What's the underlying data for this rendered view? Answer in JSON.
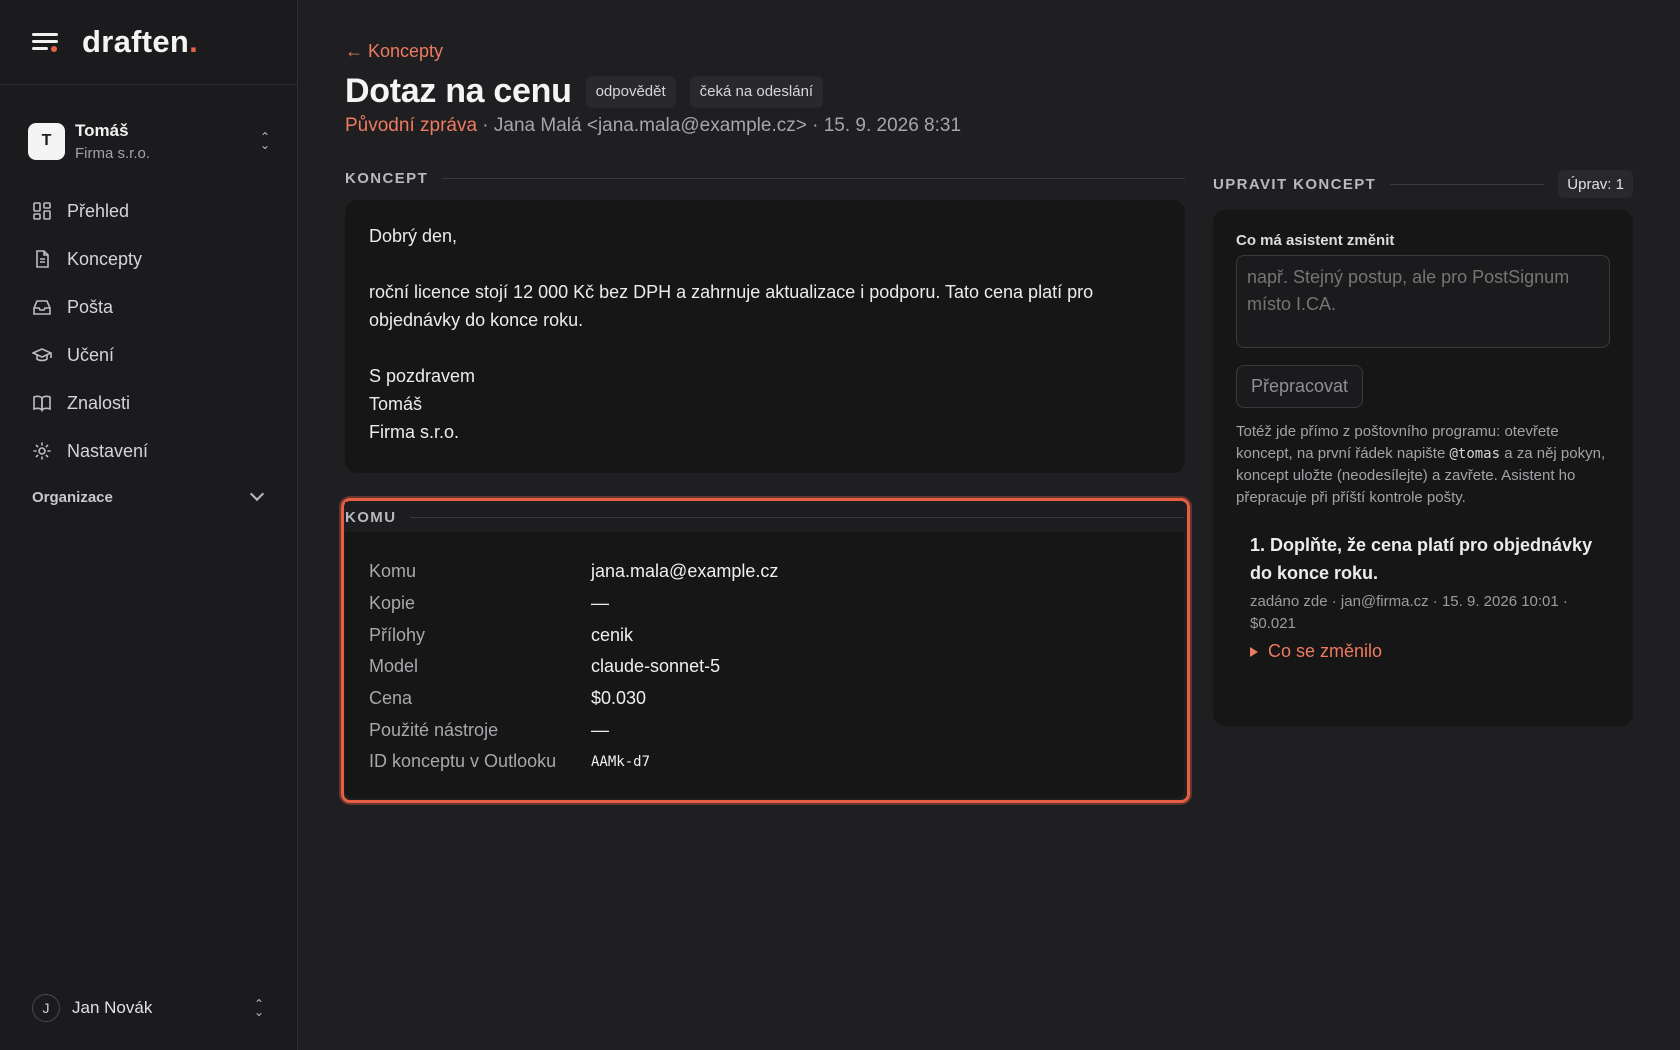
{
  "brand": {
    "name": "draften",
    "dot": "."
  },
  "account": {
    "initial": "T",
    "name": "Tomáš",
    "org": "Firma s.r.o."
  },
  "nav": {
    "items": [
      {
        "label": "Přehled",
        "icon": "dashboard-icon"
      },
      {
        "label": "Koncepty",
        "icon": "document-icon"
      },
      {
        "label": "Pošta",
        "icon": "inbox-icon"
      },
      {
        "label": "Učení",
        "icon": "graduation-cap-icon"
      },
      {
        "label": "Znalosti",
        "icon": "book-icon"
      },
      {
        "label": "Nastavení",
        "icon": "gear-icon"
      }
    ],
    "section": "Organizace"
  },
  "user": {
    "initial": "J",
    "name": "Jan Novák"
  },
  "header": {
    "back": "← Koncepty",
    "title": "Dotaz na cenu",
    "chips": [
      "odpovědět",
      "čeká na odeslání"
    ],
    "original_link": "Původní zpráva",
    "meta": " · Jana Malá <jana.mala@example.cz> · 15. 9. 2026 8:31"
  },
  "draft": {
    "section": "KONCEPT",
    "greeting": "Dobrý den,",
    "body": "roční licence stojí 12 000 Kč bez DPH a zahrnuje aktualizace i podporu. Tato cena platí pro objednávky do konce roku.",
    "closing": "S pozdravem",
    "sign_name": "Tomáš",
    "sign_org": "Firma s.r.o."
  },
  "komu": {
    "section": "KOMU",
    "rows": [
      {
        "key": "Komu",
        "value": "jana.mala@example.cz"
      },
      {
        "key": "Kopie",
        "value": "—"
      },
      {
        "key": "Přílohy",
        "value": "cenik"
      },
      {
        "key": "Model",
        "value": "claude-sonnet-5"
      },
      {
        "key": "Cena",
        "value": "$0.030"
      },
      {
        "key": "Použité nástroje",
        "value": "—"
      },
      {
        "key": "ID konceptu v Outlooku",
        "value": "AAMk-d7"
      }
    ]
  },
  "edit": {
    "section": "UPRAVIT KONCEPT",
    "count": "Úprav: 1",
    "field_label": "Co má asistent změnit",
    "placeholder": "např. Stejný postup, ale pro PostSignum místo I.CA.",
    "button": "Přepracovat",
    "hint_before": "Totéž jde přímo z poštovního programu: otevřete koncept, na první řádek napište ",
    "hint_code": "@tomas",
    "hint_after": " a za něj pokyn, koncept uložte (neodesílejte) a zavřete. Asistent ho přepracuje při příští kontrole pošty.",
    "revision": {
      "title": "1. Doplňte, že cena platí pro objednávky do konce roku.",
      "meta": "zadáno zde · jan@firma.cz · 15. 9. 2026 10:01 · $0.021",
      "toggle": "Co se změnilo"
    }
  },
  "colors": {
    "accent": "#ee7a60",
    "highlight": "#e65f43",
    "background": "#1f1f21"
  }
}
